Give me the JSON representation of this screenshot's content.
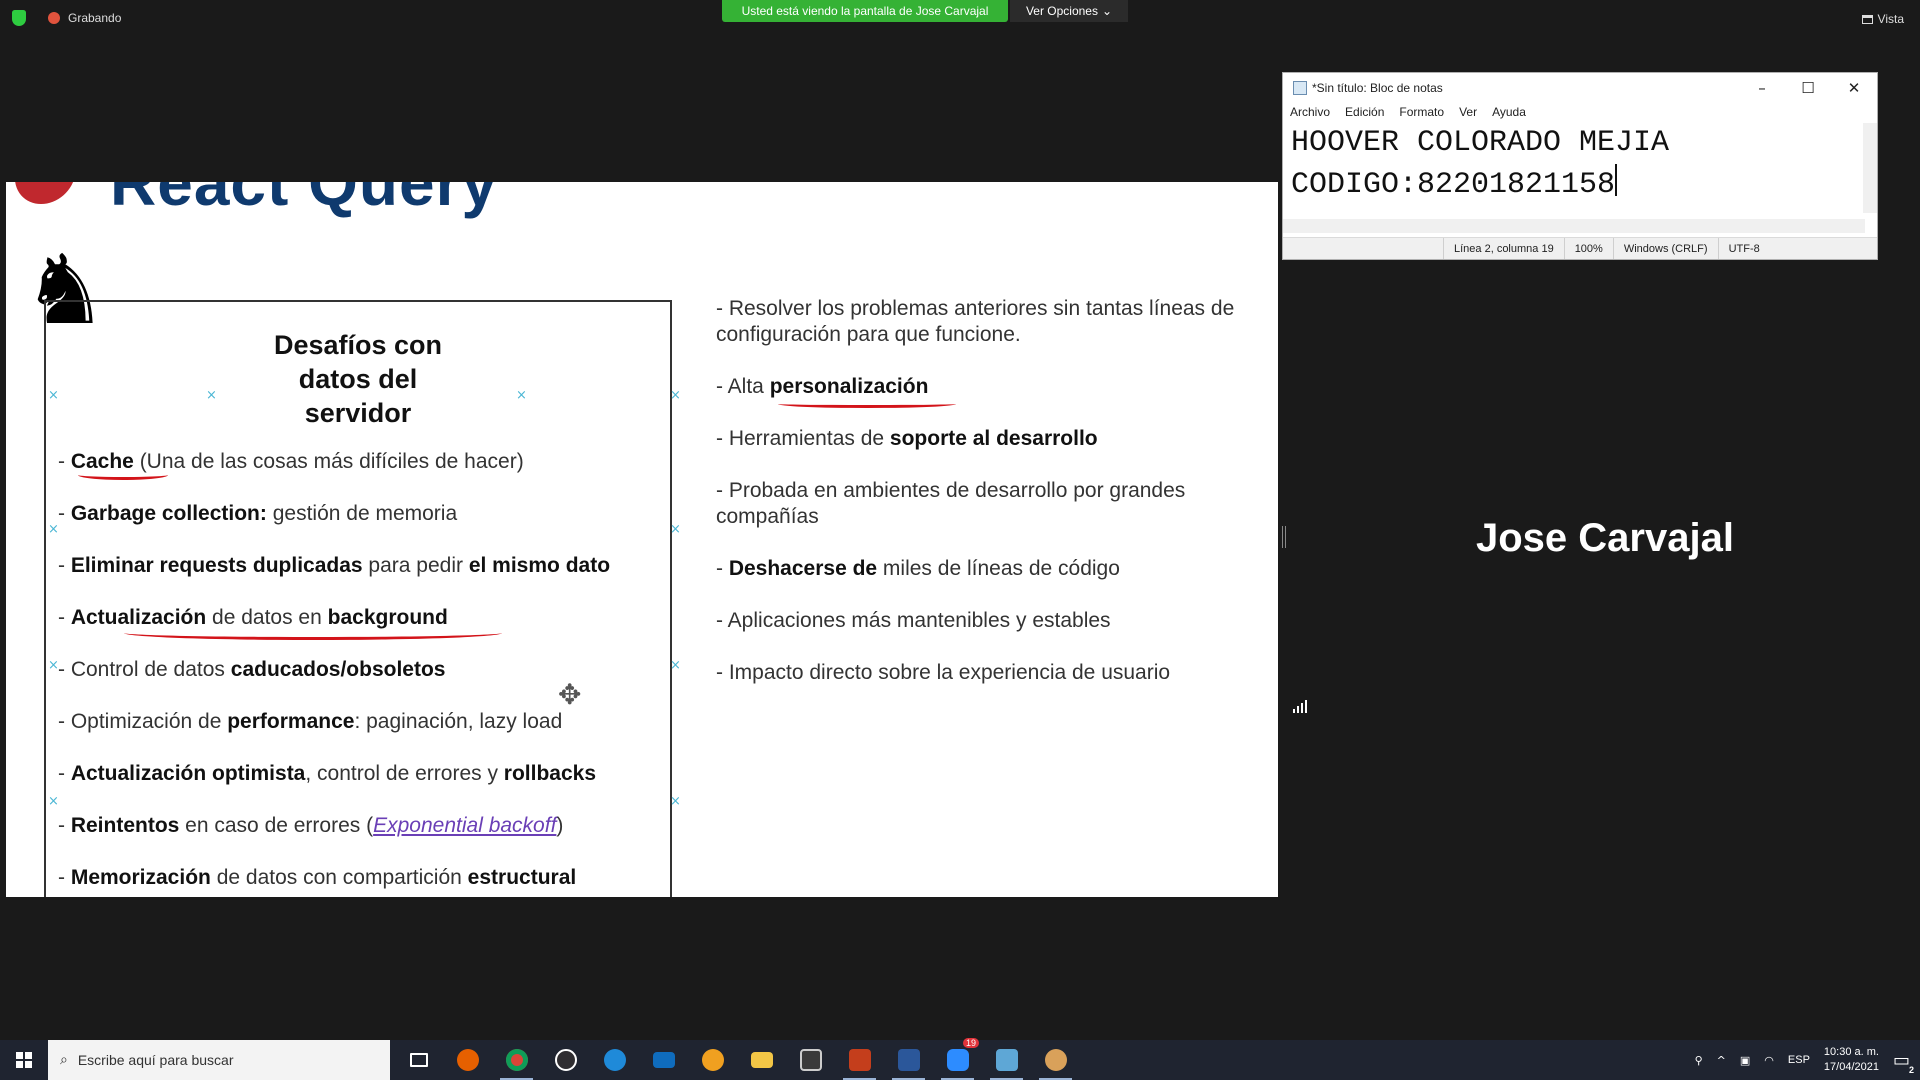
{
  "zoom_topbar": {
    "recording_label": "Grabando",
    "viewing_banner": "Usted está viendo la pantalla de Jose Carvajal",
    "options_label": "Ver Opciones",
    "view_label": "Vista"
  },
  "slide": {
    "header_title": "React Query",
    "box_title_lines": [
      "Desafíos con",
      "datos del",
      "servidor"
    ],
    "left_items": [
      {
        "b1": "Cache",
        "t1": " (Una de las cosas más difíciles de hacer)"
      },
      {
        "b1": "Garbage collection:",
        "t1": " gestión de memoria"
      },
      {
        "b1": "Eliminar requests duplicadas",
        "t1": " para pedir ",
        "b2": "el mismo dato"
      },
      {
        "b1": "Actualización",
        "t1": " de datos en ",
        "b2": "background"
      },
      {
        "t0": "Control de datos ",
        "b1": "caducados/obsoletos"
      },
      {
        "t0": "Optimización de ",
        "b1": "performance",
        "t1": ": paginación, lazy load"
      },
      {
        "b1": "Actualización optimista",
        "t1": ", control de errores y ",
        "b2": "rollbacks"
      },
      {
        "b1": "Reintentos",
        "t1": " en caso de errores (",
        "link": "Exponential backoff",
        "t2": ")"
      },
      {
        "b1": "Memorización",
        "t1": " de datos con compartición ",
        "b2": "estructural"
      }
    ],
    "right_items": [
      {
        "t0": "Resolver los problemas anteriores sin tantas líneas de configuración para que funcione."
      },
      {
        "t0": "Alta ",
        "b1": "personalización"
      },
      {
        "t0": "Herramientas de ",
        "b1": "soporte al desarrollo"
      },
      {
        "t0": "Probada en ambientes de desarrollo por grandes compañías"
      },
      {
        "b0": "Deshacerse de",
        "t1": " miles de líneas de código"
      },
      {
        "t0": "Aplicaciones más mantenibles y estables"
      },
      {
        "t0": "Impacto directo sobre la experiencia de usuario"
      }
    ]
  },
  "notepad": {
    "title": "*Sin título: Bloc de notas",
    "menu": [
      "Archivo",
      "Edición",
      "Formato",
      "Ver",
      "Ayuda"
    ],
    "lines": [
      "HOOVER COLORADO MEJIA",
      "CODIGO:82201821158"
    ],
    "status": {
      "position": "Línea 2, columna 19",
      "zoom": "100%",
      "eol": "Windows (CRLF)",
      "encoding": "UTF-8"
    }
  },
  "participant": {
    "name": "Jose Carvajal"
  },
  "taskbar": {
    "search_placeholder": "Escribe aquí para buscar",
    "apps": [
      "task-view",
      "firefox",
      "chrome",
      "obs",
      "edge",
      "mail",
      "app-orange",
      "file-explorer",
      "store",
      "powerpoint",
      "word",
      "zoom",
      "app-blue",
      "paint"
    ],
    "language": "ESP",
    "time": "10:30 a. m.",
    "date": "17/04/2021",
    "notification_count": "2",
    "zoom_badge": "19"
  },
  "colors": {
    "accent_green": "#35b235",
    "underline_red": "#d3141a",
    "link_purple": "#6a3fb6",
    "react_query_blue": "#0f3a6e"
  }
}
